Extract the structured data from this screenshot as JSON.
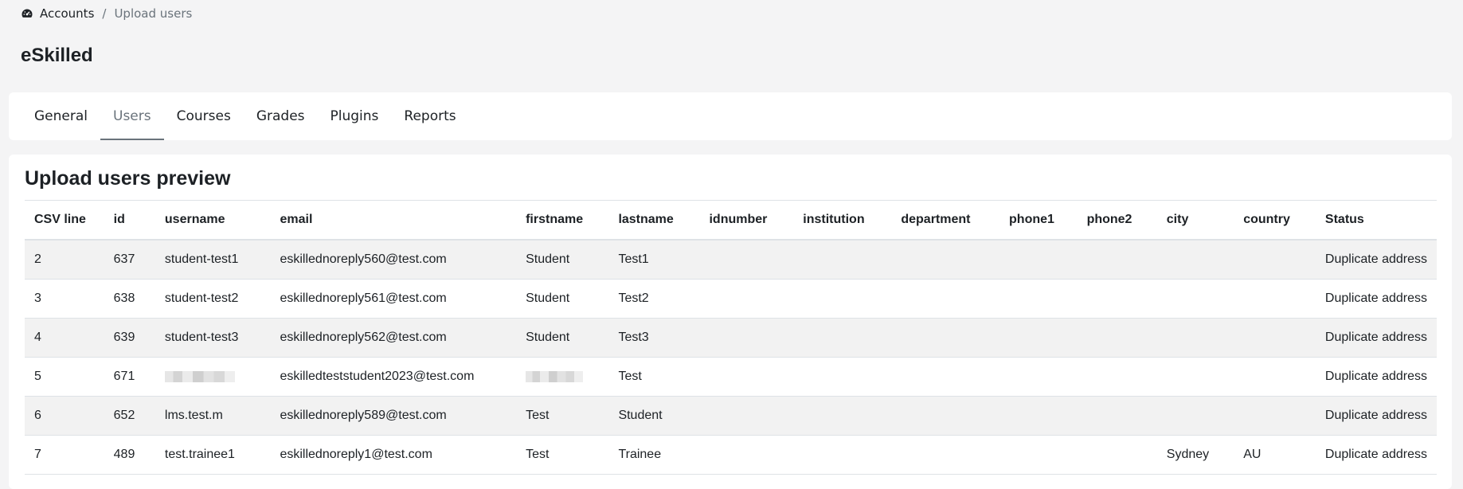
{
  "breadcrumb": {
    "items": [
      "Accounts",
      "Upload users"
    ],
    "separator": "/"
  },
  "page": {
    "title": "eSkilled"
  },
  "tabs": [
    {
      "label": "General"
    },
    {
      "label": "Users",
      "active": true
    },
    {
      "label": "Courses"
    },
    {
      "label": "Grades"
    },
    {
      "label": "Plugins"
    },
    {
      "label": "Reports"
    }
  ],
  "preview": {
    "title": "Upload users preview",
    "columns": [
      "CSV line",
      "id",
      "username",
      "email",
      "firstname",
      "lastname",
      "idnumber",
      "institution",
      "department",
      "phone1",
      "phone2",
      "city",
      "country",
      "Status"
    ],
    "rows": [
      [
        "2",
        "637",
        "student-test1",
        "eskillednoreply560@test.com",
        "Student",
        "Test1",
        "",
        "",
        "",
        "",
        "",
        "",
        "",
        "Duplicate address"
      ],
      [
        "3",
        "638",
        "student-test2",
        "eskillednoreply561@test.com",
        "Student",
        "Test2",
        "",
        "",
        "",
        "",
        "",
        "",
        "",
        "Duplicate address"
      ],
      [
        "4",
        "639",
        "student-test3",
        "eskillednoreply562@test.com",
        "Student",
        "Test3",
        "",
        "",
        "",
        "",
        "",
        "",
        "",
        "Duplicate address"
      ],
      [
        "5",
        "671",
        "",
        "eskilledteststudent2023@test.com",
        "",
        "Test",
        "",
        "",
        "",
        "",
        "",
        "",
        "",
        "Duplicate address"
      ],
      [
        "6",
        "652",
        "lms.test.m",
        "eskillednoreply589@test.com",
        "Test",
        "Student",
        "",
        "",
        "",
        "",
        "",
        "",
        "",
        "Duplicate address"
      ],
      [
        "7",
        "489",
        "test.trainee1",
        "eskillednoreply1@test.com",
        "Test",
        "Trainee",
        "",
        "",
        "",
        "",
        "",
        "Sydney",
        "AU",
        "Duplicate address"
      ]
    ],
    "redacted_cells": [
      [
        3,
        2
      ],
      [
        3,
        4
      ]
    ]
  },
  "icons": {
    "breadcrumb": "dashboard-gauge-icon"
  }
}
